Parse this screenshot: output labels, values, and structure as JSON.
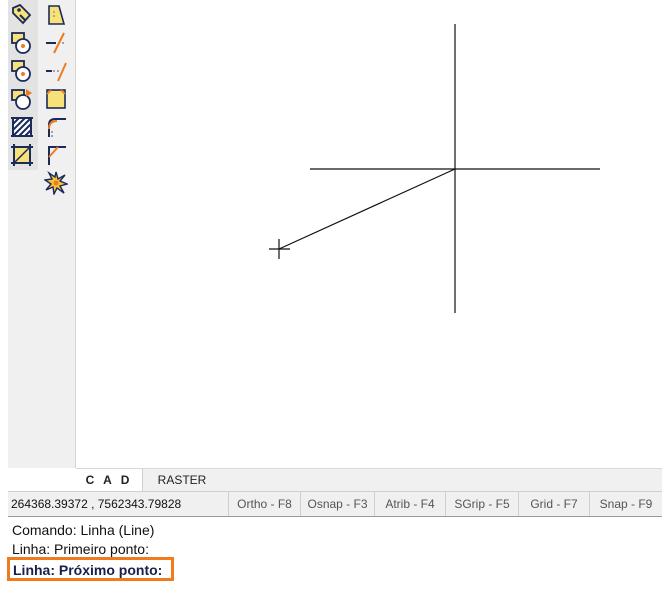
{
  "toolbar": {
    "icons": [
      "tag-icon",
      "circle-with-square-icon",
      "circle-with-square-2-icon",
      "rotate-icon",
      "hatch-icon",
      "crop-icon",
      "trapezoid-icon",
      "trim-icon",
      "extend-icon",
      "paper-icon",
      "fillet-icon",
      "chamfer-icon",
      "explode-icon"
    ]
  },
  "tabs": [
    "C A D",
    "RASTER"
  ],
  "status": {
    "coordinates": "264368.39372 , 7562343.79828",
    "buttons": [
      "Ortho - F8",
      "Osnap - F3",
      "Atrib - F4",
      "SGrip - F5",
      "Grid - F7",
      "Snap - F9"
    ]
  },
  "console": {
    "lines": [
      "Comando: Linha (Line)",
      "Linha: Primeiro ponto:"
    ],
    "prompt": "Linha: Próximo ponto:"
  },
  "colors": {
    "highlight": "#f07b1e",
    "prompt_text": "#16204a"
  }
}
